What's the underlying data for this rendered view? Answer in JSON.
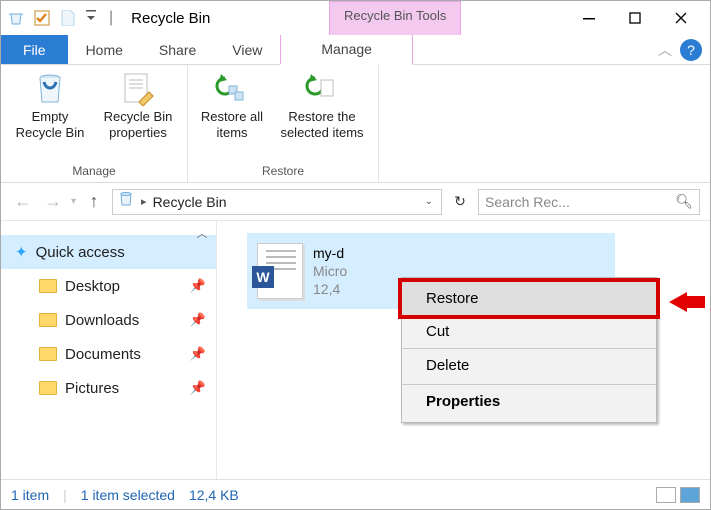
{
  "title": "Recycle Bin",
  "tool_tab": "Recycle Bin Tools",
  "ribbon_tabs": {
    "file": "File",
    "home": "Home",
    "share": "Share",
    "view": "View",
    "manage": "Manage"
  },
  "ribbon": {
    "manage_group": "Manage",
    "restore_group": "Restore",
    "empty": "Empty Recycle Bin",
    "props": "Recycle Bin properties",
    "restore_all": "Restore all items",
    "restore_sel": "Restore the selected items"
  },
  "nav": {
    "location": "Recycle Bin",
    "search_placeholder": "Search Rec..."
  },
  "sidebar": {
    "quick": "Quick access",
    "items": [
      {
        "label": "Desktop"
      },
      {
        "label": "Downloads"
      },
      {
        "label": "Documents"
      },
      {
        "label": "Pictures"
      }
    ]
  },
  "file": {
    "name": "my-d",
    "type": "Micro",
    "size": "12,4"
  },
  "context_menu": {
    "restore": "Restore",
    "cut": "Cut",
    "delete": "Delete",
    "properties": "Properties"
  },
  "status": {
    "count": "1 item",
    "selected": "1 item selected",
    "size": "12,4 KB"
  }
}
